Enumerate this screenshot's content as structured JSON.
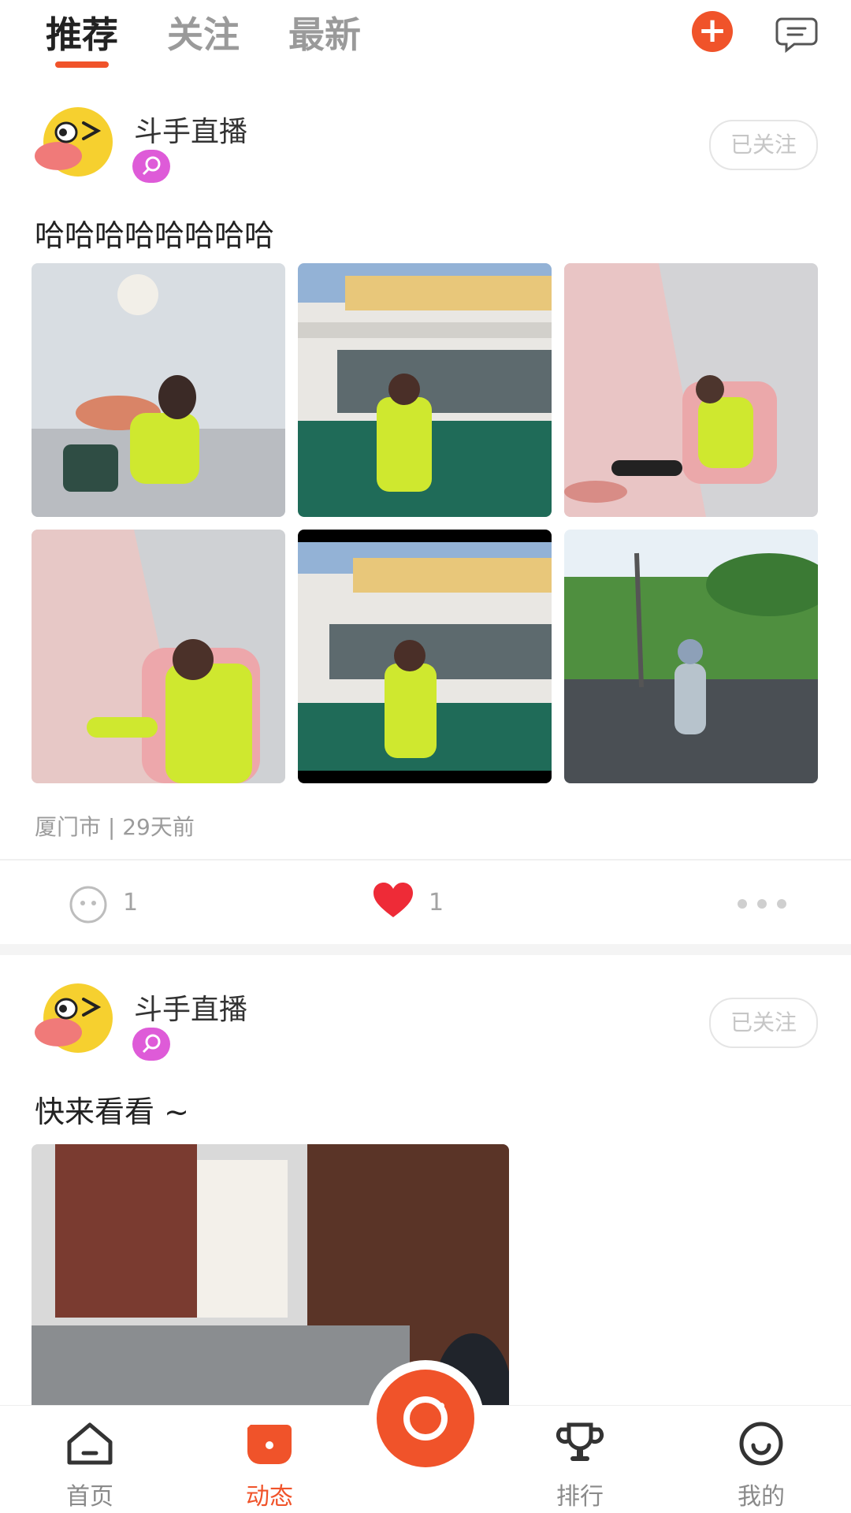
{
  "tabs": [
    "推荐",
    "关注",
    "最新"
  ],
  "posts": [
    {
      "username": "斗手直播",
      "follow_label": "已关注",
      "content": "哈哈哈哈哈哈哈哈",
      "meta": "厦门市 | 29天前",
      "comments": "1",
      "likes": "1"
    },
    {
      "username": "斗手直播",
      "follow_label": "已关注",
      "content": "快来看看 ~"
    }
  ],
  "bottom_nav": {
    "home": "首页",
    "feed": "动态",
    "rank": "排行",
    "me": "我的"
  },
  "colors": {
    "accent": "#f0532a",
    "badge": "#de5bd8",
    "heart": "#ee2b37",
    "neon": "#cfe82f"
  }
}
